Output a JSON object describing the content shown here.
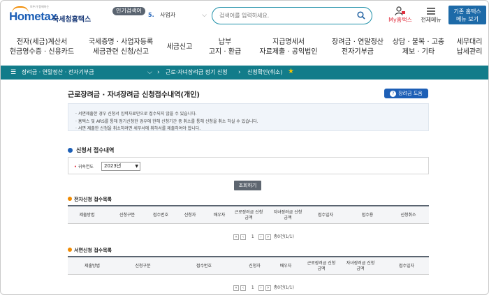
{
  "header": {
    "logo_text": "Hometax",
    "logo_brand": "국세청홈택스",
    "logo_slogan": "모두가 함께하는",
    "popular_label": "인기검색어",
    "popular_rank": "5.",
    "popular_term": "사업자",
    "search_placeholder": "검색어를 입력하세요.",
    "my_label": "My홈택스",
    "all_menu_label": "전체메뉴",
    "old_hometax_line1": "기존 홈택스",
    "old_hometax_line2": "메뉴 보기"
  },
  "gnb": [
    {
      "line1": "전자(세금)계산서",
      "line2": "현금영수증 · 신용카드"
    },
    {
      "line1": "국세증명 · 사업자등록",
      "line2": "세금관련 신청/신고"
    },
    {
      "line1": "세금신고",
      "line2": ""
    },
    {
      "line1": "납부",
      "line2": "고지 · 환급"
    },
    {
      "line1": "지급명세서",
      "line2": "자료제출 · 공익법인"
    },
    {
      "line1": "장려금 · 연말정산",
      "line2": "전자기부금"
    },
    {
      "line1": "상담 · 불복 · 고충",
      "line2": "제보 · 기타"
    },
    {
      "line1": "세무대리",
      "line2": "납세관리"
    }
  ],
  "path": {
    "seg1": "장려금 · 연말정산 · 전자기부금",
    "seg2": "근로·자녀장려금 정기 신청",
    "seg3": "신청확인(취소)"
  },
  "page": {
    "title": "근로장려금 · 자녀장려금 신청접수내역(개인)",
    "help_label": "장려금 도움",
    "notices": [
      "· 서면제출한 경우 신청서 입력자료만으로 접수되지 않을 수 있습니다.",
      "· 홈택스 및 ARS를 통해 정기신청한 경우에 한해 신청기간 중 취소를 통해 신청을 취소 하실 수 있습니다.",
      "· 서면 제출한 신청을 취소하려면 세무서에 취하서를 제출하여야 합니다."
    ],
    "section_title": "신청서 접수내역",
    "filter_label": "귀속연도",
    "filter_value": "2023년",
    "query_button": "조회하기",
    "electronic_title": "전자신청 접수목록",
    "electronic_headers": [
      "제출방법",
      "신청구분",
      "접수번호",
      "신청자",
      "배우자",
      "근로장려금 신청금액",
      "자녀장려금 신청금액",
      "접수일자",
      "접수용",
      "신청취소"
    ],
    "paper_title": "서면신청 접수목록",
    "paper_headers": [
      "제출방법",
      "신청구분",
      "접수번호",
      "신청자",
      "배우자",
      "근로장려금 신청금액",
      "자녀장려금 신청금액",
      "접수일자"
    ],
    "pager_text": "총0건(1/1)"
  }
}
